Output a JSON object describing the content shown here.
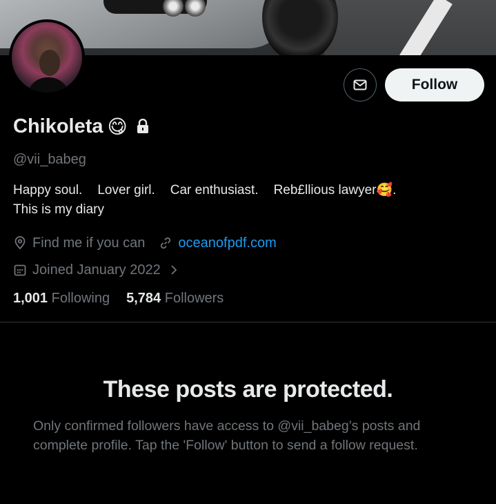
{
  "profile": {
    "name": "Chikoleta",
    "name_emoji": "😋",
    "handle": "@vii_babeg",
    "bio_line1": [
      "Happy soul.",
      "Lover girl.",
      "Car enthusiast.",
      "Reb£llious lawyer🥰."
    ],
    "bio_line2": "This is my diary",
    "location": "Find me if you can",
    "website": "oceanofpdf.com",
    "joined": "Joined January 2022",
    "following_count": "1,001",
    "following_label": "Following",
    "followers_count": "5,784",
    "followers_label": "Followers"
  },
  "actions": {
    "follow_label": "Follow"
  },
  "protected": {
    "title": "These posts are protected.",
    "description": "Only confirmed followers have access to @vii_babeg’s posts and complete profile. Tap the 'Follow' button to send a follow request."
  },
  "icons": {
    "message": "envelope-icon",
    "lock": "lock-icon",
    "location": "location-pin-icon",
    "link": "link-icon",
    "calendar": "calendar-icon",
    "chevron": "chevron-right-icon"
  },
  "colors": {
    "background": "#000000",
    "text": "#e7e9ea",
    "muted": "#71767b",
    "link": "#1d9bf0",
    "follow_button_bg": "#eff3f4"
  }
}
